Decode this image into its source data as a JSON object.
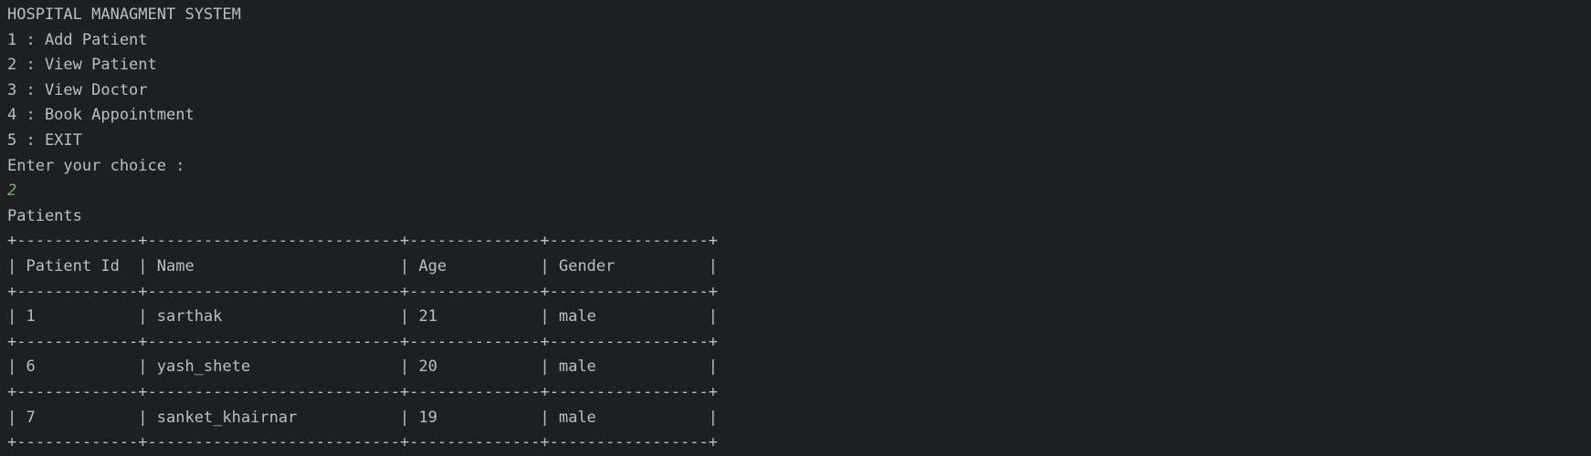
{
  "console": {
    "title": "HOSPITAL MANAGMENT SYSTEM",
    "menu": [
      "1 : Add Patient",
      "2 : View Patient",
      "3 : View Doctor",
      "4 : Book Appointment",
      "5 : EXIT"
    ],
    "prompt": "Enter your choice :",
    "user_input": "2",
    "section_title": "Patients",
    "table": {
      "border": "+-------------+---------------------------+--------------+-----------------+",
      "header": "| Patient Id  | Name                      | Age          | Gender          |",
      "rows": [
        "| 1           | sarthak                   | 21           | male            |",
        "| 6           | yash_shete                | 20           | male            |",
        "| 7           | sanket_khairnar           | 19           | male            |"
      ]
    }
  },
  "colors": {
    "background": "#1e1f22",
    "text": "#bcbec4",
    "input": "#5fb95f"
  }
}
